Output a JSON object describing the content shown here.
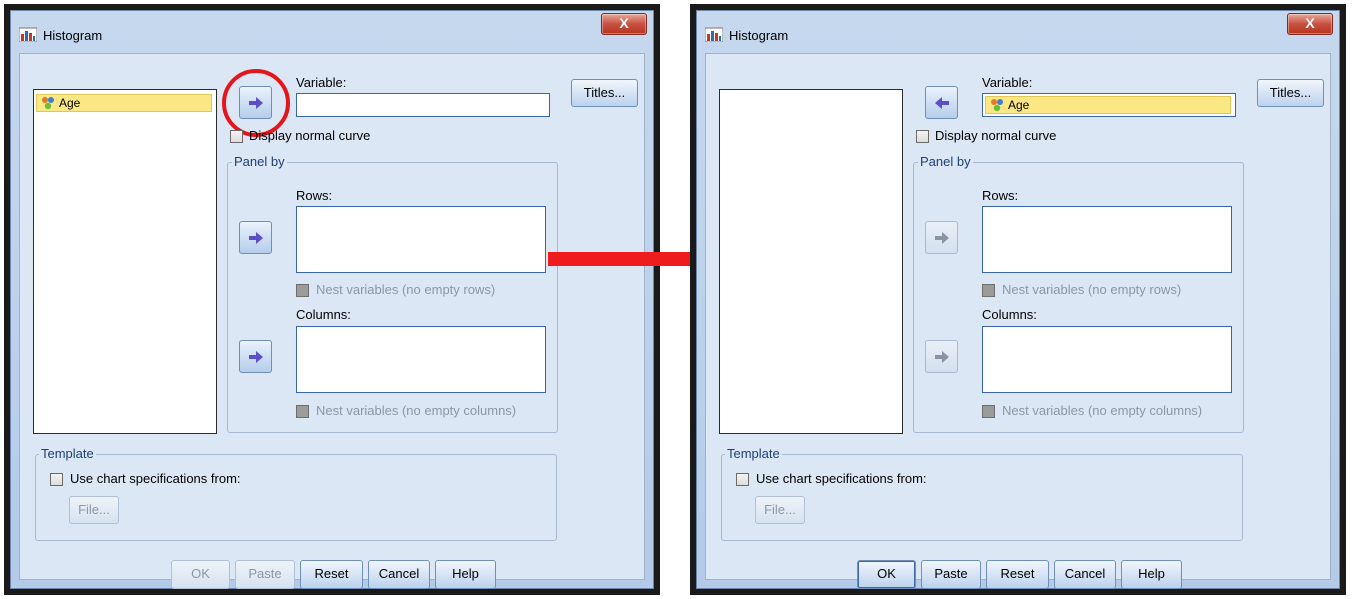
{
  "left": {
    "title": "Histogram",
    "close_label": "X",
    "source_list": [
      "Age"
    ],
    "variable_label": "Variable:",
    "variable_value": "",
    "titles_btn": "Titles...",
    "display_normal_curve": "Display normal curve",
    "panel_by": "Panel by",
    "rows_label": "Rows:",
    "nest_rows": "Nest variables (no empty rows)",
    "columns_label": "Columns:",
    "nest_columns": "Nest variables (no empty columns)",
    "template": "Template",
    "use_chart_spec": "Use chart specifications from:",
    "file_btn": "File...",
    "ok": "OK",
    "paste": "Paste",
    "reset": "Reset",
    "cancel": "Cancel",
    "help": "Help"
  },
  "right": {
    "title": "Histogram",
    "close_label": "X",
    "variable_label": "Variable:",
    "variable_value": "Age",
    "titles_btn": "Titles...",
    "display_normal_curve": "Display normal curve",
    "panel_by": "Panel by",
    "rows_label": "Rows:",
    "nest_rows": "Nest variables (no empty rows)",
    "columns_label": "Columns:",
    "nest_columns": "Nest variables (no empty columns)",
    "template": "Template",
    "use_chart_spec": "Use chart specifications from:",
    "file_btn": "File...",
    "ok": "OK",
    "paste": "Paste",
    "reset": "Reset",
    "cancel": "Cancel",
    "help": "Help"
  },
  "colors": {
    "highlight": "#e5161b",
    "selection": "#fce785",
    "dialog_bg": "#dce7f5"
  }
}
